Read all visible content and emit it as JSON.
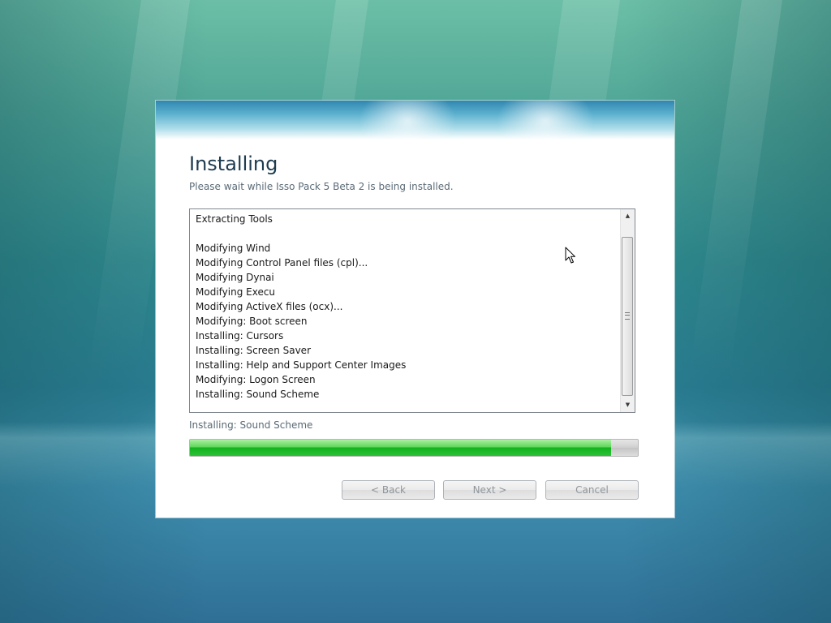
{
  "installer": {
    "title": "Installing",
    "subtitle": "Please wait while Isso Pack 5 Beta 2 is being installed.",
    "log": [
      "Extracting Tools",
      "",
      "Modifying Wind",
      "Modifying Control Panel files (cpl)...",
      "Modifying Dynai",
      "Modifying Execu",
      "Modifying ActiveX files (ocx)...",
      "Modifying: Boot screen",
      "Installing: Cursors",
      "Installing: Screen Saver",
      "Installing: Help and Support Center Images",
      "Modifying: Logon Screen",
      "Installing: Sound Scheme"
    ],
    "status": "Installing: Sound Scheme",
    "progress_fraction": 0.94,
    "buttons": {
      "back": "< Back",
      "next": "Next >",
      "cancel": "Cancel"
    }
  },
  "icons": {
    "scroll_up": "scroll-up-arrow-icon",
    "scroll_down": "scroll-down-arrow-icon",
    "cursor": "mouse-pointer-icon"
  },
  "colors": {
    "progress_green": "#14b11f",
    "title_text": "#1e3b4f",
    "desktop_teal": "#2f8a8e"
  }
}
